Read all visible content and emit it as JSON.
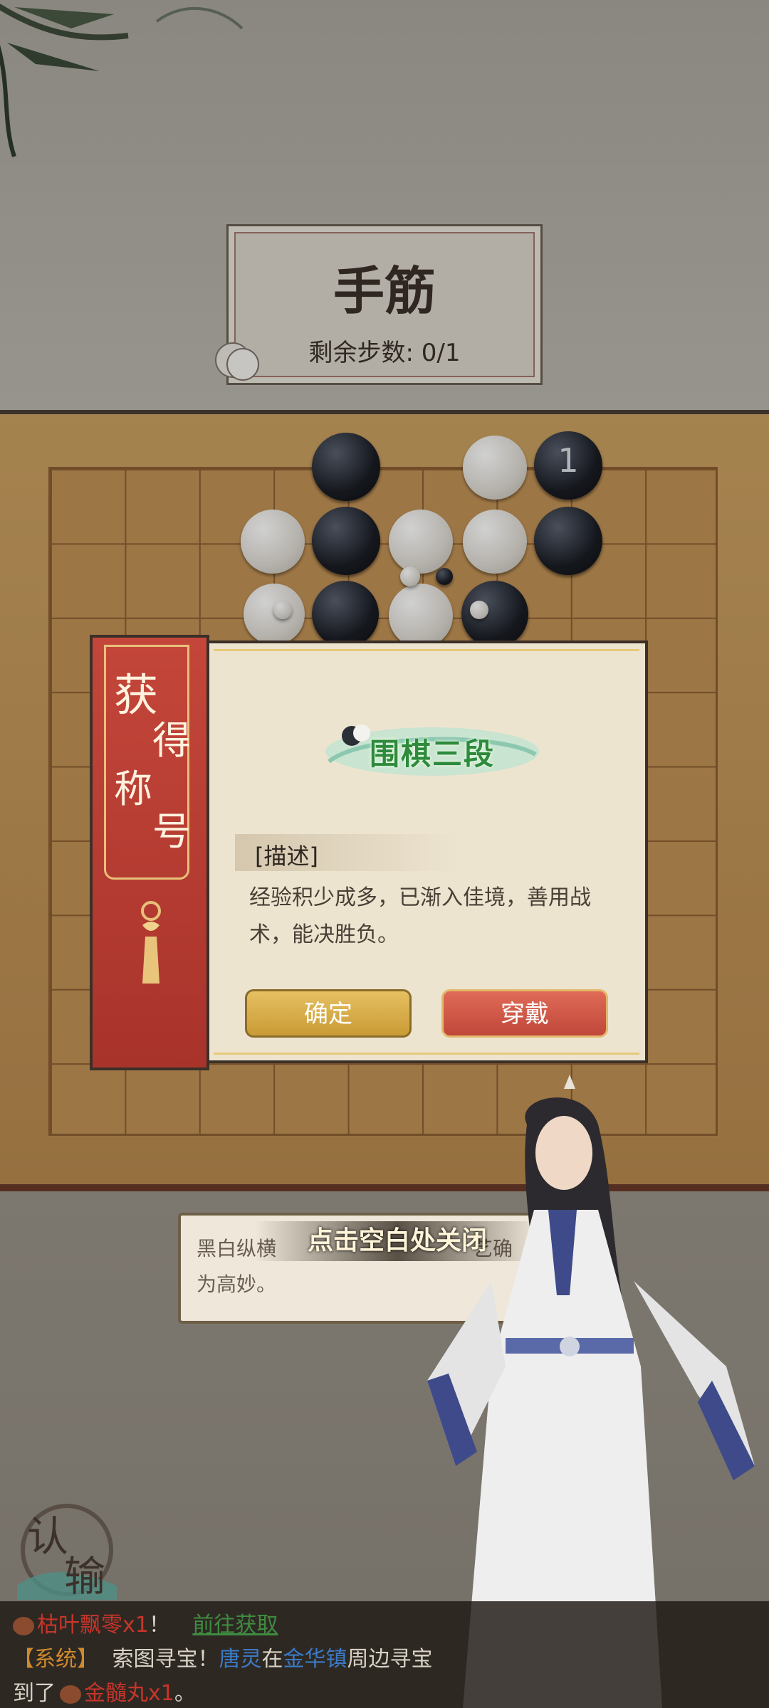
{
  "title_panel": {
    "title": "手筋",
    "steps_label": "剩余步数: 0/1"
  },
  "board": {
    "numbered_stone_label": "1"
  },
  "modal": {
    "ribbon_chars": [
      "获",
      "得",
      "称",
      "号"
    ],
    "badge_text": "围棋三段",
    "desc_header": "[描述]",
    "desc_line1": "经验积少成多，已渐入佳境，善用战",
    "desc_line2": "术，能决胜负。",
    "confirm_label": "确定",
    "wear_label": "穿戴"
  },
  "tip": {
    "close_hint": "点击空白处关闭",
    "line1_left": "黑白纵横",
    "line1_right": "艺确",
    "line2": "为高妙。"
  },
  "resign": {
    "chars": [
      "认",
      "输"
    ]
  },
  "chat": {
    "line1_item": "枯叶飘零x1",
    "line1_mark": "！",
    "line1_link": "前往获取",
    "line2_tag": "【系统】",
    "line2_text1": "索图寻宝！",
    "line2_name": "唐灵",
    "line2_text2": "在",
    "line2_place": "金华镇",
    "line2_text3": "周边寻宝",
    "line3_text1": "到了",
    "line3_item": "金髓丸x1",
    "line3_end": "。"
  }
}
